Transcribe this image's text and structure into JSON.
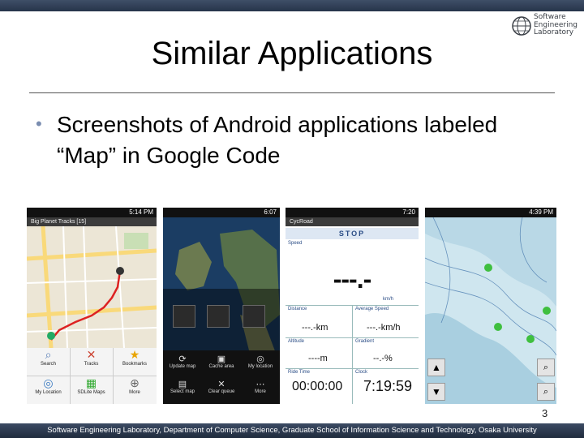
{
  "slide": {
    "title": "Similar Applications",
    "bullet": "Screenshots of Android applications labeled “Map” in Google Code",
    "page_number": "3",
    "footer": "Software Engineering Laboratory, Department of Computer Science, Graduate School of Information Science and Technology, Osaka University"
  },
  "logo": {
    "line1": "Software",
    "line2": "Engineering",
    "line3": "Laboratory"
  },
  "screenshots": [
    {
      "time": "5:14 PM",
      "title": "Big Planet Tracks [15]",
      "buttons": [
        "Search",
        "Tracks",
        "Bookmarks",
        "My Location",
        "SDLite Maps",
        "More"
      ]
    },
    {
      "time": "6:07",
      "title": "",
      "buttons": [
        "Update map",
        "Cache area",
        "My location",
        "Select map",
        "Clear queue",
        "More"
      ]
    },
    {
      "time": "7:20",
      "title": "CycRoad",
      "stop_label": "STOP",
      "labels": [
        "Speed",
        "km/h",
        "Distance",
        "Average Speed",
        "Altitude",
        "Gradient",
        "Ride Time",
        "Clock"
      ],
      "values": [
        "---.-",
        "---.-km",
        "---.-km/h",
        "----m",
        "--.-%",
        "00:00:00",
        "7:19:59"
      ]
    },
    {
      "time": "4:39 PM"
    }
  ]
}
